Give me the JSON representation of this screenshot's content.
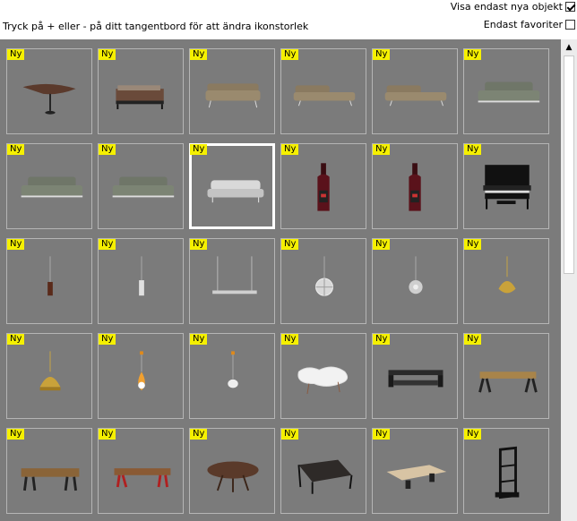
{
  "options": {
    "show_new_label": "Visa endast nya objekt",
    "show_new_checked": true,
    "favorites_label": "Endast favoriter",
    "favorites_checked": false
  },
  "hint": "Tryck på + eller - på ditt tangentbord för att ändra ikonstorlek",
  "badge_color": "#f5f000",
  "gallery_bg": "#7b7b7b",
  "items": [
    {
      "badge": "Ny",
      "icon": "lounge-chair-icon",
      "selected": false
    },
    {
      "badge": "Ny",
      "icon": "bed-icon",
      "selected": false
    },
    {
      "badge": "Ny",
      "icon": "sofa-icon",
      "selected": false
    },
    {
      "badge": "Ny",
      "icon": "chaise-sofa-icon",
      "selected": false
    },
    {
      "badge": "Ny",
      "icon": "chaise-sofa-icon",
      "selected": false
    },
    {
      "badge": "Ny",
      "icon": "grey-sofa-icon",
      "selected": false
    },
    {
      "badge": "Ny",
      "icon": "grey-sofa-icon",
      "selected": false
    },
    {
      "badge": "Ny",
      "icon": "grey-sofa-icon",
      "selected": false
    },
    {
      "badge": "Ny",
      "icon": "white-sofa-icon",
      "selected": true
    },
    {
      "badge": "Ny",
      "icon": "wine-bottle-icon",
      "selected": false
    },
    {
      "badge": "Ny",
      "icon": "wine-bottle-icon",
      "selected": false
    },
    {
      "badge": "Ny",
      "icon": "piano-icon",
      "selected": false
    },
    {
      "badge": "Ny",
      "icon": "pendant-lamp-dark-icon",
      "selected": false
    },
    {
      "badge": "Ny",
      "icon": "pendant-lamp-white-icon",
      "selected": false
    },
    {
      "badge": "Ny",
      "icon": "linear-pendant-icon",
      "selected": false
    },
    {
      "badge": "Ny",
      "icon": "globe-pendant-icon",
      "selected": false
    },
    {
      "badge": "Ny",
      "icon": "sphere-pendant-icon",
      "selected": false
    },
    {
      "badge": "Ny",
      "icon": "gold-pendant-icon",
      "selected": false
    },
    {
      "badge": "Ny",
      "icon": "gold-dome-pendant-icon",
      "selected": false
    },
    {
      "badge": "Ny",
      "icon": "drop-pendant-icon",
      "selected": false
    },
    {
      "badge": "Ny",
      "icon": "glass-pendant-icon",
      "selected": false
    },
    {
      "badge": "Ny",
      "icon": "coffee-table-icon",
      "selected": false
    },
    {
      "badge": "Ny",
      "icon": "dark-bench-icon",
      "selected": false
    },
    {
      "badge": "Ny",
      "icon": "wood-bench-icon",
      "selected": false
    },
    {
      "badge": "Ny",
      "icon": "wood-table-icon",
      "selected": false
    },
    {
      "badge": "Ny",
      "icon": "red-leg-bench-icon",
      "selected": false
    },
    {
      "badge": "Ny",
      "icon": "round-table-icon",
      "selected": false
    },
    {
      "badge": "Ny",
      "icon": "dark-table-icon",
      "selected": false
    },
    {
      "badge": "Ny",
      "icon": "light-table-icon",
      "selected": false
    },
    {
      "badge": "Ny",
      "icon": "shelf-icon",
      "selected": false
    }
  ]
}
